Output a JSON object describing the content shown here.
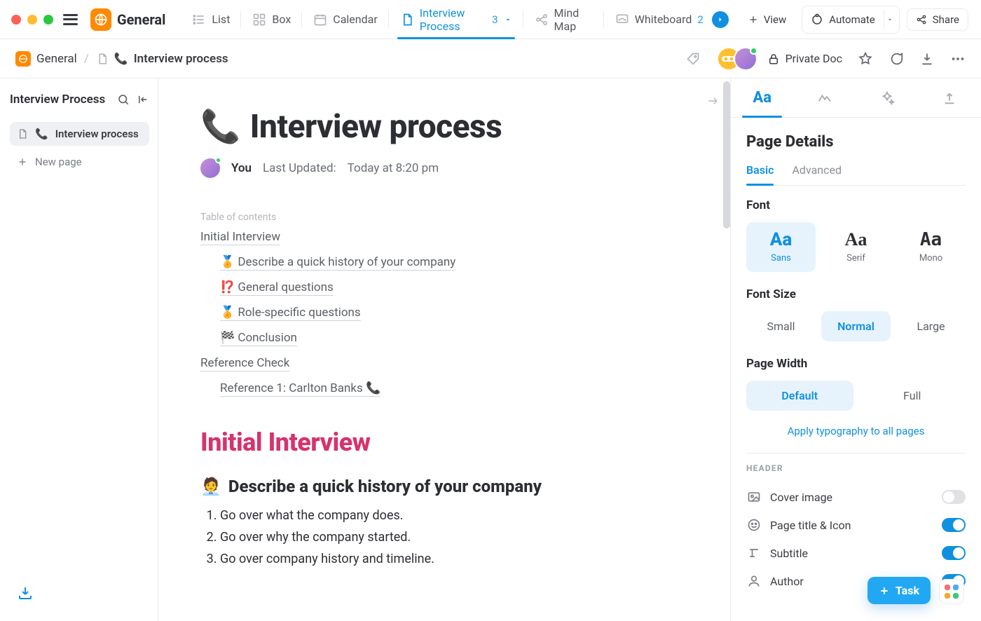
{
  "workspace": {
    "name": "General"
  },
  "views": {
    "list": {
      "label": "List"
    },
    "box": {
      "label": "Box"
    },
    "cal": {
      "label": "Calendar"
    },
    "doc": {
      "label": "Interview Process",
      "count": "3"
    },
    "mind": {
      "label": "Mind Map"
    },
    "wb": {
      "label": "Whiteboard",
      "count": "2"
    },
    "add": {
      "label": "View"
    }
  },
  "topbar": {
    "automate": "Automate",
    "share": "Share"
  },
  "breadcrumb": {
    "root": "General",
    "doc": "Interview process",
    "doc_emoji": "📞",
    "private": "Private Doc"
  },
  "sidebar": {
    "title": "Interview Process",
    "items": [
      {
        "emoji": "📞",
        "label": "Interview process"
      }
    ],
    "new_page": "New page"
  },
  "document": {
    "emoji": "📞",
    "title": "Interview process",
    "you": "You",
    "updated_label": "Last Updated:",
    "updated_value": "Today at 8:20 pm",
    "toc_label": "Table of contents",
    "toc": {
      "a": "Initial Interview",
      "b": "🏅 Describe a quick history of your company",
      "c": "⁉️ General questions",
      "d": "🏅 Role-specific questions",
      "e": "🏁 Conclusion",
      "f": "Reference Check",
      "g": "Reference 1: Carlton Banks 📞"
    },
    "h1": "Initial Interview",
    "h2_emoji": "🧑‍💼",
    "h2": "Describe a quick history of your company",
    "points": [
      "Go over what the company does.",
      "Go over why the company started.",
      "Go over company history and timeline."
    ]
  },
  "panel": {
    "title": "Page Details",
    "tabs": {
      "basic": "Basic",
      "advanced": "Advanced"
    },
    "font_label": "Font",
    "fonts": {
      "sans": "Sans",
      "serif": "Serif",
      "mono": "Mono",
      "sample": "Aa"
    },
    "size_label": "Font Size",
    "sizes": {
      "small": "Small",
      "normal": "Normal",
      "large": "Large"
    },
    "width_label": "Page Width",
    "widths": {
      "default": "Default",
      "full": "Full"
    },
    "apply_all": "Apply typography to all pages",
    "header_label": "HEADER",
    "toggles": {
      "cover": "Cover image",
      "title_icon": "Page title & Icon",
      "subtitle": "Subtitle",
      "author": "Author"
    }
  },
  "fab": {
    "task": "Task"
  }
}
